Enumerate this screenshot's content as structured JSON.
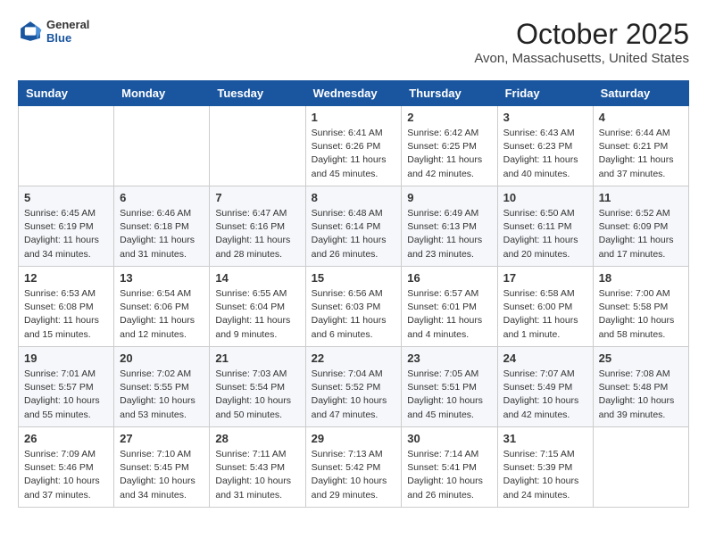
{
  "header": {
    "logo_general": "General",
    "logo_blue": "Blue",
    "month": "October 2025",
    "location": "Avon, Massachusetts, United States"
  },
  "days_of_week": [
    "Sunday",
    "Monday",
    "Tuesday",
    "Wednesday",
    "Thursday",
    "Friday",
    "Saturday"
  ],
  "weeks": [
    [
      {
        "day": "",
        "info": ""
      },
      {
        "day": "",
        "info": ""
      },
      {
        "day": "",
        "info": ""
      },
      {
        "day": "1",
        "info": "Sunrise: 6:41 AM\nSunset: 6:26 PM\nDaylight: 11 hours and 45 minutes."
      },
      {
        "day": "2",
        "info": "Sunrise: 6:42 AM\nSunset: 6:25 PM\nDaylight: 11 hours and 42 minutes."
      },
      {
        "day": "3",
        "info": "Sunrise: 6:43 AM\nSunset: 6:23 PM\nDaylight: 11 hours and 40 minutes."
      },
      {
        "day": "4",
        "info": "Sunrise: 6:44 AM\nSunset: 6:21 PM\nDaylight: 11 hours and 37 minutes."
      }
    ],
    [
      {
        "day": "5",
        "info": "Sunrise: 6:45 AM\nSunset: 6:19 PM\nDaylight: 11 hours and 34 minutes."
      },
      {
        "day": "6",
        "info": "Sunrise: 6:46 AM\nSunset: 6:18 PM\nDaylight: 11 hours and 31 minutes."
      },
      {
        "day": "7",
        "info": "Sunrise: 6:47 AM\nSunset: 6:16 PM\nDaylight: 11 hours and 28 minutes."
      },
      {
        "day": "8",
        "info": "Sunrise: 6:48 AM\nSunset: 6:14 PM\nDaylight: 11 hours and 26 minutes."
      },
      {
        "day": "9",
        "info": "Sunrise: 6:49 AM\nSunset: 6:13 PM\nDaylight: 11 hours and 23 minutes."
      },
      {
        "day": "10",
        "info": "Sunrise: 6:50 AM\nSunset: 6:11 PM\nDaylight: 11 hours and 20 minutes."
      },
      {
        "day": "11",
        "info": "Sunrise: 6:52 AM\nSunset: 6:09 PM\nDaylight: 11 hours and 17 minutes."
      }
    ],
    [
      {
        "day": "12",
        "info": "Sunrise: 6:53 AM\nSunset: 6:08 PM\nDaylight: 11 hours and 15 minutes."
      },
      {
        "day": "13",
        "info": "Sunrise: 6:54 AM\nSunset: 6:06 PM\nDaylight: 11 hours and 12 minutes."
      },
      {
        "day": "14",
        "info": "Sunrise: 6:55 AM\nSunset: 6:04 PM\nDaylight: 11 hours and 9 minutes."
      },
      {
        "day": "15",
        "info": "Sunrise: 6:56 AM\nSunset: 6:03 PM\nDaylight: 11 hours and 6 minutes."
      },
      {
        "day": "16",
        "info": "Sunrise: 6:57 AM\nSunset: 6:01 PM\nDaylight: 11 hours and 4 minutes."
      },
      {
        "day": "17",
        "info": "Sunrise: 6:58 AM\nSunset: 6:00 PM\nDaylight: 11 hours and 1 minute."
      },
      {
        "day": "18",
        "info": "Sunrise: 7:00 AM\nSunset: 5:58 PM\nDaylight: 10 hours and 58 minutes."
      }
    ],
    [
      {
        "day": "19",
        "info": "Sunrise: 7:01 AM\nSunset: 5:57 PM\nDaylight: 10 hours and 55 minutes."
      },
      {
        "day": "20",
        "info": "Sunrise: 7:02 AM\nSunset: 5:55 PM\nDaylight: 10 hours and 53 minutes."
      },
      {
        "day": "21",
        "info": "Sunrise: 7:03 AM\nSunset: 5:54 PM\nDaylight: 10 hours and 50 minutes."
      },
      {
        "day": "22",
        "info": "Sunrise: 7:04 AM\nSunset: 5:52 PM\nDaylight: 10 hours and 47 minutes."
      },
      {
        "day": "23",
        "info": "Sunrise: 7:05 AM\nSunset: 5:51 PM\nDaylight: 10 hours and 45 minutes."
      },
      {
        "day": "24",
        "info": "Sunrise: 7:07 AM\nSunset: 5:49 PM\nDaylight: 10 hours and 42 minutes."
      },
      {
        "day": "25",
        "info": "Sunrise: 7:08 AM\nSunset: 5:48 PM\nDaylight: 10 hours and 39 minutes."
      }
    ],
    [
      {
        "day": "26",
        "info": "Sunrise: 7:09 AM\nSunset: 5:46 PM\nDaylight: 10 hours and 37 minutes."
      },
      {
        "day": "27",
        "info": "Sunrise: 7:10 AM\nSunset: 5:45 PM\nDaylight: 10 hours and 34 minutes."
      },
      {
        "day": "28",
        "info": "Sunrise: 7:11 AM\nSunset: 5:43 PM\nDaylight: 10 hours and 31 minutes."
      },
      {
        "day": "29",
        "info": "Sunrise: 7:13 AM\nSunset: 5:42 PM\nDaylight: 10 hours and 29 minutes."
      },
      {
        "day": "30",
        "info": "Sunrise: 7:14 AM\nSunset: 5:41 PM\nDaylight: 10 hours and 26 minutes."
      },
      {
        "day": "31",
        "info": "Sunrise: 7:15 AM\nSunset: 5:39 PM\nDaylight: 10 hours and 24 minutes."
      },
      {
        "day": "",
        "info": ""
      }
    ]
  ]
}
